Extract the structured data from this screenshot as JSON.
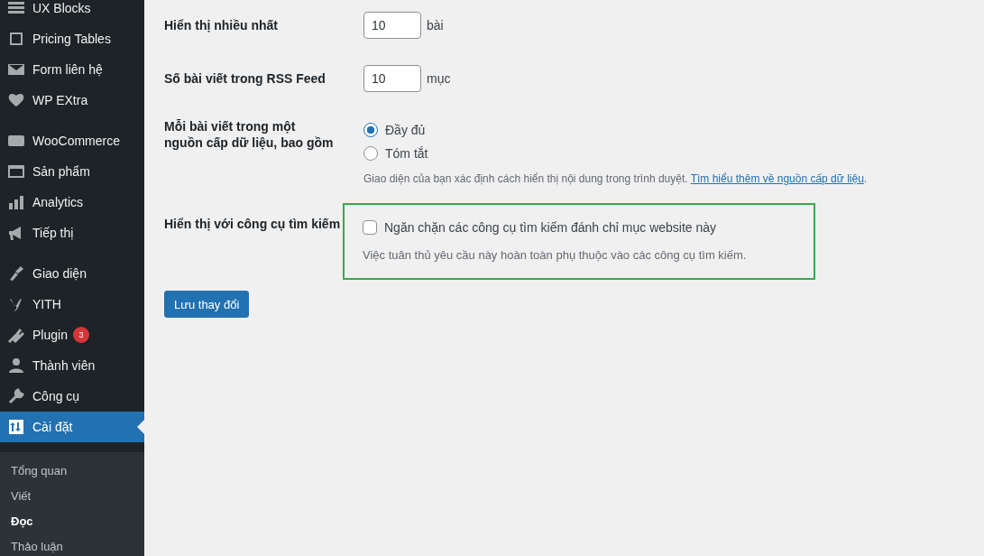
{
  "sidebar": {
    "groups": [
      {
        "items": [
          {
            "label": "UX Blocks",
            "selected": false
          },
          {
            "label": "Pricing Tables",
            "selected": false
          },
          {
            "label": "Form liên hệ",
            "selected": false
          },
          {
            "label": "WP EXtra",
            "selected": false
          }
        ]
      },
      {
        "items": [
          {
            "label": "WooCommerce",
            "selected": false
          },
          {
            "label": "Sản phẩm",
            "selected": false
          },
          {
            "label": "Analytics",
            "selected": false
          },
          {
            "label": "Tiếp thị",
            "selected": false
          }
        ]
      },
      {
        "items": [
          {
            "label": "Giao diện",
            "selected": false
          },
          {
            "label": "YITH",
            "selected": false
          },
          {
            "label": "Plugin",
            "selected": false,
            "badge": "3"
          },
          {
            "label": "Thành viên",
            "selected": false
          },
          {
            "label": "Công cụ",
            "selected": false
          },
          {
            "label": "Cài đặt",
            "selected": true
          }
        ]
      }
    ],
    "submenu": [
      {
        "label": "Tổng quan",
        "selected": false
      },
      {
        "label": "Viết",
        "selected": false
      },
      {
        "label": "Đọc",
        "selected": true
      },
      {
        "label": "Thảo luận",
        "selected": false
      }
    ]
  },
  "settings": {
    "rows": [
      {
        "kind": "number",
        "label": "Hiển thị nhiều nhất",
        "value": "10",
        "unit": "bài"
      },
      {
        "kind": "number",
        "label": "Số bài viết trong RSS Feed",
        "value": "10",
        "unit": "mục"
      },
      {
        "kind": "radio",
        "label": "Mỗi bài viết trong một nguồn cấp dữ liệu, bao gồm",
        "options": [
          {
            "label": "Đầy đủ",
            "selected": true
          },
          {
            "label": "Tóm tắt",
            "selected": false
          }
        ],
        "description": "Giao diện của bạn xác định cách hiển thị nội dung trong trình duyệt.",
        "link": "Tìm hiểu thêm về nguồn cấp dữ liệu",
        "after_link": "."
      },
      {
        "kind": "checkbox",
        "label": "Hiển thị với công cụ tìm kiếm",
        "highlighted": true,
        "checkbox_label": "Ngăn chặn các công cụ tìm kiếm đánh chỉ mục website này",
        "checked": false,
        "description": "Việc tuân thủ yêu cầu này hoàn toàn phụ thuộc vào các công cụ tìm kiếm."
      }
    ]
  },
  "save_button": "Lưu thay đổi"
}
